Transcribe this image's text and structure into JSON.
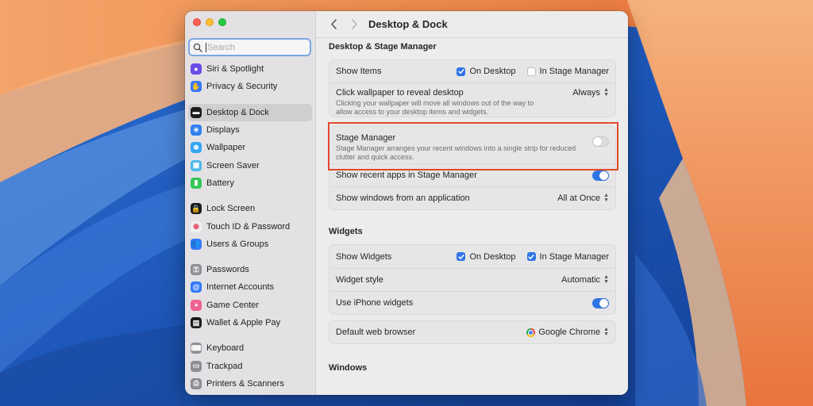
{
  "window": {
    "title": "Desktop & Dock"
  },
  "search": {
    "placeholder": "Search",
    "value": ""
  },
  "sidebar": {
    "items": [
      {
        "label": "Siri & Spotlight",
        "icon": "siri-icon",
        "color": "#6b4ce6"
      },
      {
        "label": "Privacy & Security",
        "icon": "hand-icon",
        "color": "#3478f6"
      },
      {
        "label": "Desktop & Dock",
        "icon": "dock-icon",
        "color": "#1c1c1e",
        "selected": true
      },
      {
        "label": "Displays",
        "icon": "sun-icon",
        "color": "#2f80f0"
      },
      {
        "label": "Wallpaper",
        "icon": "snowflake-icon",
        "color": "#35a7f2"
      },
      {
        "label": "Screen Saver",
        "icon": "screen-saver-icon",
        "color": "#4fb8e8"
      },
      {
        "label": "Battery",
        "icon": "battery-icon",
        "color": "#34c759"
      },
      {
        "label": "Lock Screen",
        "icon": "lock-icon",
        "color": "#1c1c1e"
      },
      {
        "label": "Touch ID & Password",
        "icon": "fingerprint-icon",
        "color": "#f0f0f0"
      },
      {
        "label": "Users & Groups",
        "icon": "users-icon",
        "color": "#3478f6"
      },
      {
        "label": "Passwords",
        "icon": "key-icon",
        "color": "#8e8e93"
      },
      {
        "label": "Internet Accounts",
        "icon": "at-icon",
        "color": "#3478f6"
      },
      {
        "label": "Game Center",
        "icon": "game-center-icon",
        "color": "#f06292"
      },
      {
        "label": "Wallet & Apple Pay",
        "icon": "wallet-icon",
        "color": "#1c1c1e"
      },
      {
        "label": "Keyboard",
        "icon": "keyboard-icon",
        "color": "#8e8e93"
      },
      {
        "label": "Trackpad",
        "icon": "trackpad-icon",
        "color": "#8e8e93"
      },
      {
        "label": "Printers & Scanners",
        "icon": "printer-icon",
        "color": "#8e8e93"
      }
    ]
  },
  "main": {
    "section_desktop": "Desktop & Stage Manager",
    "show_items_label": "Show Items",
    "show_items_on_desktop": "On Desktop",
    "show_items_on_desktop_checked": true,
    "show_items_in_stage_manager": "In Stage Manager",
    "show_items_in_stage_manager_checked": false,
    "click_wallpaper_label": "Click wallpaper to reveal desktop",
    "click_wallpaper_value": "Always",
    "click_wallpaper_desc": "Clicking your wallpaper will move all windows out of the way to allow access to your desktop items and widgets.",
    "stage_manager_label": "Stage Manager",
    "stage_manager_desc": "Stage Manager arranges your recent windows into a single strip for reduced clutter and quick access.",
    "stage_manager_on": false,
    "recent_apps_label": "Show recent apps in Stage Manager",
    "recent_apps_on": true,
    "show_windows_label": "Show windows from an application",
    "show_windows_value": "All at Once",
    "section_widgets": "Widgets",
    "show_widgets_label": "Show Widgets",
    "show_widgets_on_desktop": "On Desktop",
    "show_widgets_on_desktop_checked": true,
    "show_widgets_in_stage_manager": "In Stage Manager",
    "show_widgets_in_stage_manager_checked": true,
    "widget_style_label": "Widget style",
    "widget_style_value": "Automatic",
    "iphone_widgets_label": "Use iPhone widgets",
    "iphone_widgets_on": true,
    "browser_label": "Default web browser",
    "browser_value": "Google Chrome",
    "section_windows": "Windows"
  },
  "colors": {
    "accent": "#2f74e6",
    "highlight": "#e2482c"
  }
}
